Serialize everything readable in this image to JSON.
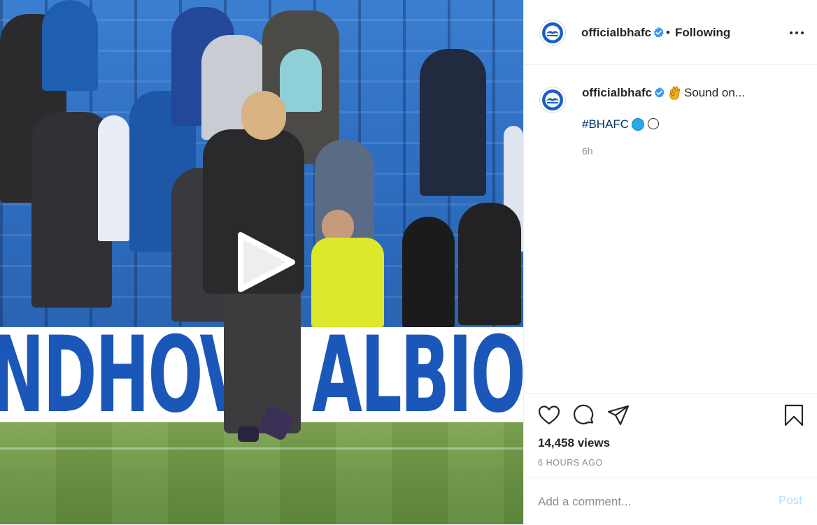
{
  "post": {
    "username": "officialbhafc",
    "follow_separator": "•",
    "follow_status": "Following",
    "caption": "Sound on...",
    "caption_emoji_icon": "ok-hand-emoji",
    "hashtag": "#BHAFC",
    "hashtag_emoji_icons": [
      "blue-circle",
      "white-circle"
    ],
    "caption_time": "6h",
    "views": "14,458 views",
    "posted_ago": "6 HOURS AGO"
  },
  "media": {
    "type": "video",
    "board_text": "NDHOVE ALBION",
    "play_icon": "play-icon"
  },
  "actions": {
    "like_icon": "heart-icon",
    "comment_icon": "comment-icon",
    "share_icon": "paper-plane-icon",
    "save_icon": "bookmark-icon"
  },
  "comment": {
    "placeholder": "Add a comment...",
    "post_label": "Post"
  },
  "colors": {
    "verified": "#3897f0",
    "hashtag": "#00376b",
    "post_disabled": "#b2dffc",
    "muted": "#8e8e8e"
  }
}
